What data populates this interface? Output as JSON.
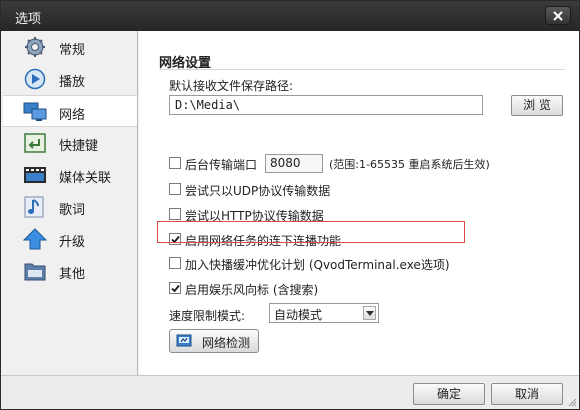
{
  "window": {
    "title": "选项"
  },
  "colors": {
    "titlebar": "#2e2e2e",
    "selected_nav": "#ffffff",
    "highlight_border": "#d94a4a",
    "accent_blue": "#2c6fb8"
  },
  "sidebar": {
    "items": [
      {
        "label": "常规",
        "icon": "gear-icon"
      },
      {
        "label": "播放",
        "icon": "play-icon"
      },
      {
        "label": "网络",
        "icon": "network-icon",
        "selected": true
      },
      {
        "label": "快捷键",
        "icon": "keyboard-icon"
      },
      {
        "label": "媒体关联",
        "icon": "film-icon"
      },
      {
        "label": "歌词",
        "icon": "music-note-icon"
      },
      {
        "label": "升级",
        "icon": "upgrade-arrow-icon"
      },
      {
        "label": "其他",
        "icon": "etc-folder-icon"
      }
    ]
  },
  "network": {
    "section_title": "网络设置",
    "save_path_label": "默认接收文件保存路径:",
    "save_path_value": "D:\\Media\\",
    "browse_label": "浏 览",
    "background_port_label": "后台传输端口",
    "background_port_checked": false,
    "port_value": "8080",
    "port_hint": "(范围:1-65535 重启系统后生效)",
    "udp_only_label": "尝试只以UDP协议传输数据",
    "udp_only_checked": false,
    "http_label": "尝试以HTTP协议传输数据",
    "http_checked": false,
    "continuous_play_label": "启用网络任务的连下连播功能",
    "continuous_play_checked": true,
    "qvod_plan_label": "加入快播缓冲优化计划 (QvodTerminal.exe选项)",
    "qvod_plan_checked": false,
    "entertainment_label": "启用娱乐风向标 (含搜索)",
    "entertainment_checked": true,
    "speed_limit_label": "速度限制模式:",
    "speed_limit_value": "自动模式",
    "net_check_label": "网络检测"
  },
  "footer": {
    "ok_label": "确定",
    "cancel_label": "取消"
  }
}
